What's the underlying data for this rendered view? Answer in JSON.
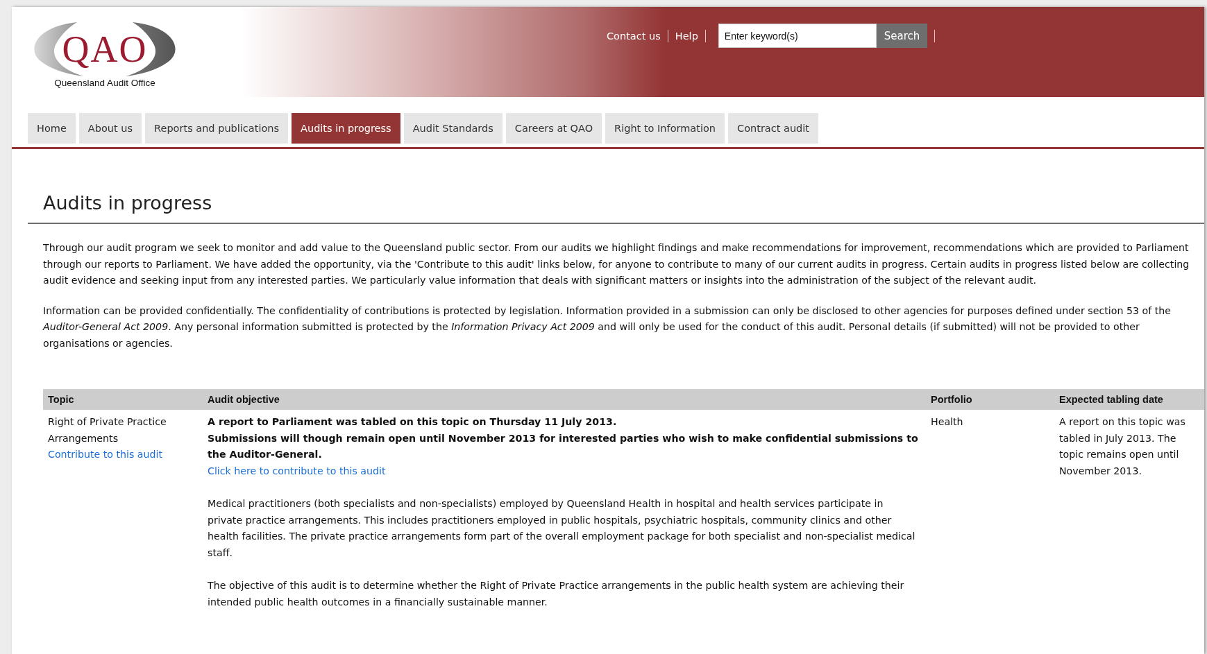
{
  "logo": {
    "mark": "QAO",
    "caption": "Queensland Audit Office"
  },
  "top_links": [
    "Contact us",
    "Help"
  ],
  "search": {
    "placeholder": "Enter keyword(s)",
    "button": "Search"
  },
  "nav": [
    {
      "label": "Home",
      "selected": false
    },
    {
      "label": "About us",
      "selected": false
    },
    {
      "label": "Reports and publications",
      "selected": false
    },
    {
      "label": "Audits in progress",
      "selected": true
    },
    {
      "label": "Audit Standards",
      "selected": false
    },
    {
      "label": "Careers at QAO",
      "selected": false
    },
    {
      "label": "Right to Information",
      "selected": false
    },
    {
      "label": "Contract audit",
      "selected": false
    }
  ],
  "page_title": "Audits in progress",
  "intro": [
    "Through our audit program we seek to monitor and add value to the Queensland public sector. From our audits we highlight findings and make recommendations for improvement, recommendations which are provided to Parliament through our reports to Parliament. We have added the opportunity, via the 'Contribute to this audit' links below, for anyone to contribute to many of our current audits in progress. Certain audits in progress listed below are collecting audit evidence and seeking input from any interested parties. We particularly value information that deals with significant matters or insights into the administration of the subject of the relevant audit.",
    "Information can be provided confidentially. The confidentiality of contributions is protected by legislation. Information provided in a submission can only be disclosed to other agencies for purposes defined under section 53 of the *Auditor-General Act 2009*. Any personal information submitted is protected by the *Information Privacy Act 2009* and will only be used for the conduct of this audit. Personal details (if submitted) will not be provided to other organisations or agencies."
  ],
  "table": {
    "columns": [
      "Topic",
      "Audit objective",
      "Portfolio",
      "Expected tabling date"
    ],
    "rows": [
      {
        "topic": "Right of Private Practice Arrangements",
        "topic_link": "Contribute to this audit",
        "notices": [
          "A report to Parliament was tabled on this topic on Thursday 11 July 2013.",
          "Submissions will though remain open until November 2013 for interested parties who wish to make confidential submissions to the Auditor-General."
        ],
        "objective_link": "Click here to contribute to this audit",
        "objective_paragraphs": [
          "Medical practitioners (both specialists and non-specialists) employed by Queensland Health in hospital and health services participate in private practice arrangements. This includes practitioners employed in public hospitals, psychiatric hospitals, community clinics and other health facilities. The private practice arrangements form part of the overall employment package for both specialist and non-specialist medical staff.",
          "The objective of this audit is to determine whether the Right of Private Practice arrangements in the public health system are achieving their intended public health outcomes in a financially sustainable manner."
        ],
        "portfolio": "Health",
        "tabling_date": "A report on this topic was tabled in July 2013. The topic remains open until November 2013."
      }
    ]
  }
}
